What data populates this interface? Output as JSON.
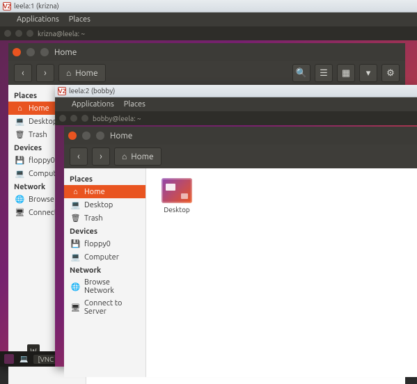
{
  "vnc1": {
    "title": "leela:1 (krizna)",
    "icon": "V2"
  },
  "vnc2": {
    "title": "leela:2 (bobby)",
    "icon": "V2"
  },
  "menubar": {
    "applications": "Applications",
    "places": "Places"
  },
  "terminal1": "krizna@leela: ~",
  "terminal2": "bobby@leela: ~",
  "nautilus": {
    "title": "Home",
    "location": "Home",
    "sidebar": {
      "places_header": "Places",
      "home": "Home",
      "desktop": "Desktop",
      "trash": "Trash",
      "devices_header": "Devices",
      "floppy": "floppy0",
      "computer": "Computer",
      "network_header": "Network",
      "browse": "Browse Network",
      "connect": "Connect to Server"
    },
    "content": {
      "desktop_folder": "Desktop"
    }
  },
  "nautilus1_short": {
    "desktop": "Desktop",
    "trash": "Trash",
    "floppy": "floppy0",
    "computer": "Computer",
    "browse": "Browse",
    "connect": "Connect"
  },
  "taskbar": {
    "item": "[VNC"
  },
  "corner": "W"
}
